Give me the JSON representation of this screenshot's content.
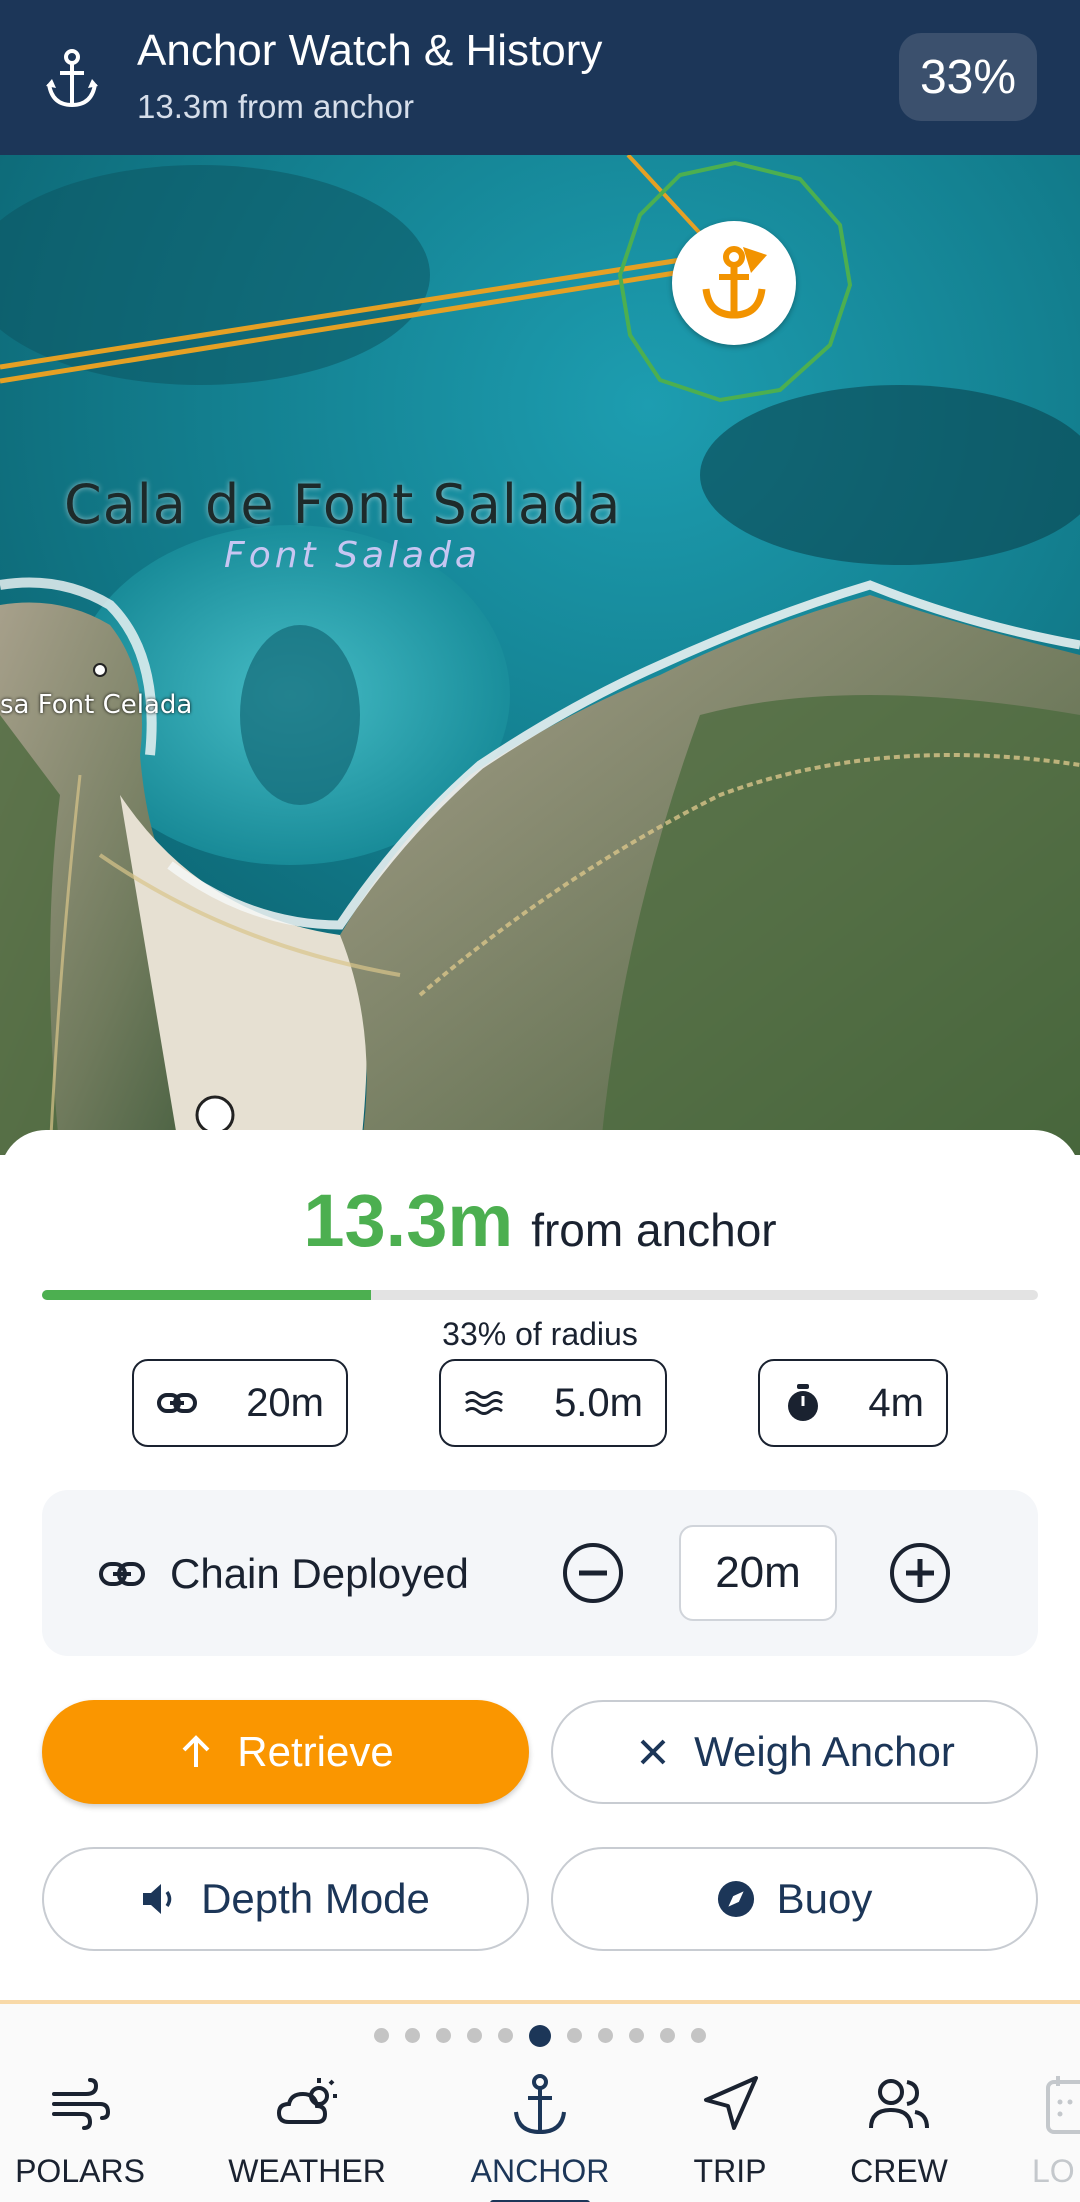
{
  "header": {
    "title": "Anchor Watch & History",
    "subtitle": "13.3m from anchor",
    "percent_badge": "33%",
    "background": "#1c3658"
  },
  "map": {
    "place_main": "Cala de Font Salada",
    "place_sub": "Font Salada",
    "place_small": "sa Font Celada",
    "swing_circle_color": "#4caf50",
    "track_color": "#f0a020",
    "marker_icon": "anchor-icon"
  },
  "sheet": {
    "distance_value": "13.3m",
    "distance_label": "from anchor",
    "radius_fraction": 0.33,
    "radius_label": "33% of radius",
    "chips": {
      "chain": {
        "icon": "link-icon",
        "value": "20m"
      },
      "depth": {
        "icon": "waves-icon",
        "value": "5.0m"
      },
      "timer": {
        "icon": "stopwatch-icon",
        "value": "4m"
      }
    },
    "chain_deployed": {
      "label": "Chain Deployed",
      "value": "20m"
    },
    "buttons": {
      "retrieve": "Retrieve",
      "weigh": "Weigh Anchor",
      "depth_mode": "Depth Mode",
      "buoy": "Buoy"
    },
    "accent_color": "#fa9600",
    "good_color": "#4caf50"
  },
  "nav": {
    "page_count": 11,
    "active_page": 5,
    "items": [
      {
        "label": "POLARS",
        "icon": "wind-icon"
      },
      {
        "label": "WEATHER",
        "icon": "weather-icon"
      },
      {
        "label": "ANCHOR",
        "icon": "anchor-icon",
        "active": true
      },
      {
        "label": "TRIP",
        "icon": "navigation-arrow-icon"
      },
      {
        "label": "CREW",
        "icon": "people-icon"
      },
      {
        "label": "LO",
        "icon": "logbook-icon"
      }
    ]
  }
}
